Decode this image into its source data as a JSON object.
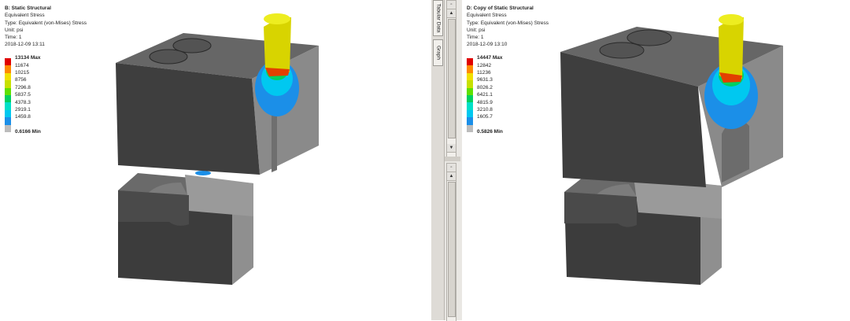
{
  "left_view": {
    "title": "B: Static Structural",
    "result": "Equivalent Stress",
    "type": "Type: Equivalent (von-Mises) Stress",
    "unit": "Unit: psi",
    "time": "Time: 1",
    "timestamp": "2018-12-09 13:11",
    "legend": [
      {
        "label": "13134 Max",
        "color": "#e00000"
      },
      {
        "label": "11674",
        "color": "#ff8a00"
      },
      {
        "label": "10215",
        "color": "#f2e000"
      },
      {
        "label": "8756",
        "color": "#c7e000"
      },
      {
        "label": "7296.8",
        "color": "#5fe000"
      },
      {
        "label": "5837.5",
        "color": "#00d060"
      },
      {
        "label": "4378.3",
        "color": "#00e0c8"
      },
      {
        "label": "2919.1",
        "color": "#00c8f0"
      },
      {
        "label": "1459.8",
        "color": "#1b8fe8"
      },
      {
        "label": "0.6166 Min",
        "color": "#bcbcbc"
      }
    ]
  },
  "right_view": {
    "title": "D: Copy of Static Structural",
    "result": "Equivalent Stress",
    "type": "Type: Equivalent (von-Mises) Stress",
    "unit": "Unit: psi",
    "time": "Time: 1",
    "timestamp": "2018-12-09 13:10",
    "legend": [
      {
        "label": "14447 Max",
        "color": "#e00000"
      },
      {
        "label": "12842",
        "color": "#ff8a00"
      },
      {
        "label": "11236",
        "color": "#f2e000"
      },
      {
        "label": "9631.3",
        "color": "#c7e000"
      },
      {
        "label": "8026.2",
        "color": "#5fe000"
      },
      {
        "label": "6421.1",
        "color": "#00d060"
      },
      {
        "label": "4815.9",
        "color": "#00e0c8"
      },
      {
        "label": "3210.8",
        "color": "#00c8f0"
      },
      {
        "label": "1605.7",
        "color": "#1b8fe8"
      },
      {
        "label": "0.5826 Min",
        "color": "#bcbcbc"
      }
    ]
  },
  "side_tabs": {
    "tabular": "Tabular Data",
    "graph": "Graph"
  },
  "icons": {
    "scroll_up": "scroll-up-icon",
    "scroll_down": "scroll-down-icon",
    "pin": "pin-icon"
  },
  "colors": {
    "block_front": "#3e3e3e",
    "block_top": "#5a5a5a",
    "block_side": "#909090",
    "punch": "#e3e000"
  }
}
